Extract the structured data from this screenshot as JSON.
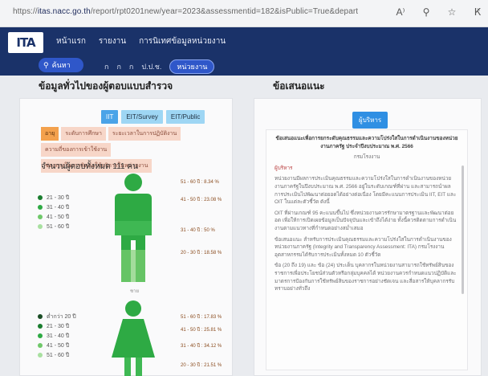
{
  "browser": {
    "url_prefix": "https://",
    "url_host": "itas.nacc.go.th",
    "url_path": "/report/rpt0201new/year=2023&assessmentid=182&isPublic=True&departmentid=352",
    "icons": [
      "read-aloud-icon",
      "zoom-icon",
      "favorite-star-icon",
      "reader-icon"
    ]
  },
  "header": {
    "logo_text": "ITA",
    "nav": [
      "หน้าแรก",
      "รายงาน",
      "การนิเทศข้อมูลหน่วยงาน"
    ],
    "search_label": "ค้นหา",
    "filters": [
      "ก",
      "ก",
      "ก",
      "ป.ป.ช.",
      "หน่วยงาน"
    ]
  },
  "left": {
    "title": "ข้อมูลทั่วไปของผู้ตอบแบบสำรวจ",
    "tabs": [
      {
        "label": "IIT",
        "active": true
      },
      {
        "label": "EIT/Survey",
        "active": false
      },
      {
        "label": "EIT/Public",
        "active": false
      }
    ],
    "chips": [
      {
        "label": "อายุ",
        "active": true
      },
      {
        "label": "ระดับการศึกษา",
        "active": false
      },
      {
        "label": "ระยะเวลาในการปฏิบัติงาน",
        "active": false
      },
      {
        "label": "ความถี่ของการเข้าใช้งาน",
        "active": false
      },
      {
        "label": "ช่องทางในการติดต่อใช้บริการในหน่วยงาน",
        "active": false
      }
    ],
    "count_label": "จำนวนผู้ตอบทั้งหมด 111 คน",
    "male": {
      "caption": "ชาย",
      "legend": [
        "21 - 30 ปี",
        "31 - 40 ปี",
        "41 - 50 ปี",
        "51 - 60 ปี"
      ],
      "stats": [
        "51 - 60 ปี : 8.34 %",
        "41 - 50 ปี : 23.08 %",
        "31 - 40 ปี : 50 %",
        "20 - 30 ปี : 18.58 %"
      ]
    },
    "female": {
      "legend": [
        "ต่ำกว่า 20 ปี",
        "21 - 30 ปี",
        "31 - 40 ปี",
        "41 - 50 ปี",
        "51 - 60 ปี"
      ],
      "stats": [
        "51 - 60 ปี : 17.83 %",
        "41 - 50 ปี : 25.81 %",
        "31 - 40 ปี : 34.12 %",
        "20 - 30 ปี : 21.51 %"
      ]
    },
    "colors": {
      "figure": "#2eaa44",
      "figure_light": "#7fcf74",
      "dot1": "#1a7d2f",
      "dot2": "#2eaa44",
      "dot3": "#6fc86a",
      "dot4": "#a8e0a0",
      "dot5": "#cfeccb"
    }
  },
  "right": {
    "title": "ข้อเสนอแนะ",
    "button_label": "ผู้บริหาร",
    "paragraphs": [
      "ข้อเสนอแนะเพื่อการยกระดับคุณธรรมและความโปร่งใสในการดำเนินงานของหน่วยงานภาครัฐ ประจำปีงบประมาณ พ.ศ. 2566",
      "กรมโรงงาน",
      "ผู้บริหาร",
      "หน่วยงานมีผลการประเมินคุณธรรมและความโปร่งใสในการดำเนินงานของหน่วยงานภาครัฐในปีงบประมาณ พ.ศ. 2566 อยู่ในระดับเกณฑ์ที่ผ่าน และสามารถนำผลการประเมินไปพัฒนาต่อยอดได้อย่างต่อเนื่อง โดยมีคะแนนการประเมิน IIT, EIT และ OIT ในแต่ละตัวชี้วัด ดังนี้",
      "OIT ที่ผ่านเกณฑ์ 95 คะแนนขึ้นไป ซึ่งหน่วยงานควรรักษามาตรฐานและพัฒนาต่อยอด เพื่อให้การเปิดเผยข้อมูลเป็นปัจจุบันและเข้าถึงได้ง่าย ทั้งนี้ควรติดตามการดำเนินงานตามแนวทางที่กำหนดอย่างสม่ำเสมอ",
      "ข้อเสนอแนะ สำหรับการประเมินคุณธรรมและความโปร่งใสในการดำเนินงานของหน่วยงานภาครัฐ (Integrity and Transparency Assessment: ITA) กรมโรงงานอุตสาหกรรมได้รับการประเมินทั้งหมด 10 ตัวชี้วัด",
      "ข้อ (20 ถึง 19) และ ข้อ (24) ประเด็น บุคลากรในหน่วยงานสามารถใช้ทรัพย์สินของราชการเพื่อประโยชน์ส่วนตัวหรือกลุ่มบุคคลได้ หน่วยงานควรกำหนดแนวปฏิบัติและมาตรการป้องกันการใช้ทรัพย์สินของราชการอย่างชัดเจน และสื่อสารให้บุคลากรรับทราบอย่างทั่วถึง"
    ]
  }
}
